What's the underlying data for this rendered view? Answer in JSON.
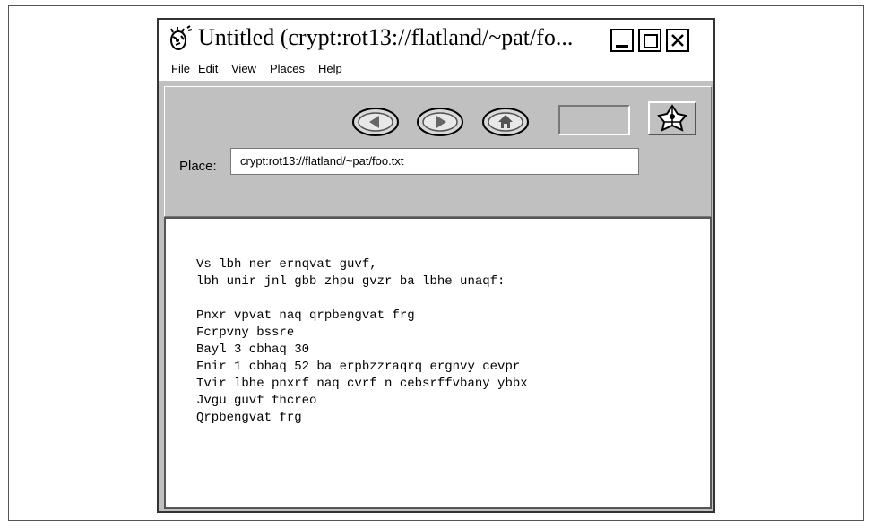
{
  "window": {
    "title": "Untitled (crypt:rot13://flatland/~pat/fo..."
  },
  "menu": {
    "items": [
      "File",
      "Edit",
      "View",
      "Places",
      "Help"
    ]
  },
  "toolbar": {
    "place_label": "Place:",
    "place_value": "crypt:rot13://flatland/~pat/foo.txt"
  },
  "document": {
    "lines": [
      "Vs lbh ner ernqvat guvf,",
      "lbh unir jnl gbb zhpu gvzr ba lbhe unaqf:",
      "",
      "Pnxr vpvat naq qrpbengvat frg",
      "Fcrpvny bssre",
      "Bayl 3 cbhaq 30",
      "Fnir 1 cbhaq 52 ba erpbzzraqrq ergnvy cevpr",
      "Tvir lbhe pnxrf naq cvrf n cebsrffvbany ybbx",
      "Jvgu guvf fhcreo",
      "Qrpbengvat frg"
    ]
  },
  "icons": {
    "app": "bug-icon",
    "back": "back-arrow-icon",
    "forward": "forward-arrow-icon",
    "home": "home-icon",
    "logo": "apple-logo-icon"
  }
}
